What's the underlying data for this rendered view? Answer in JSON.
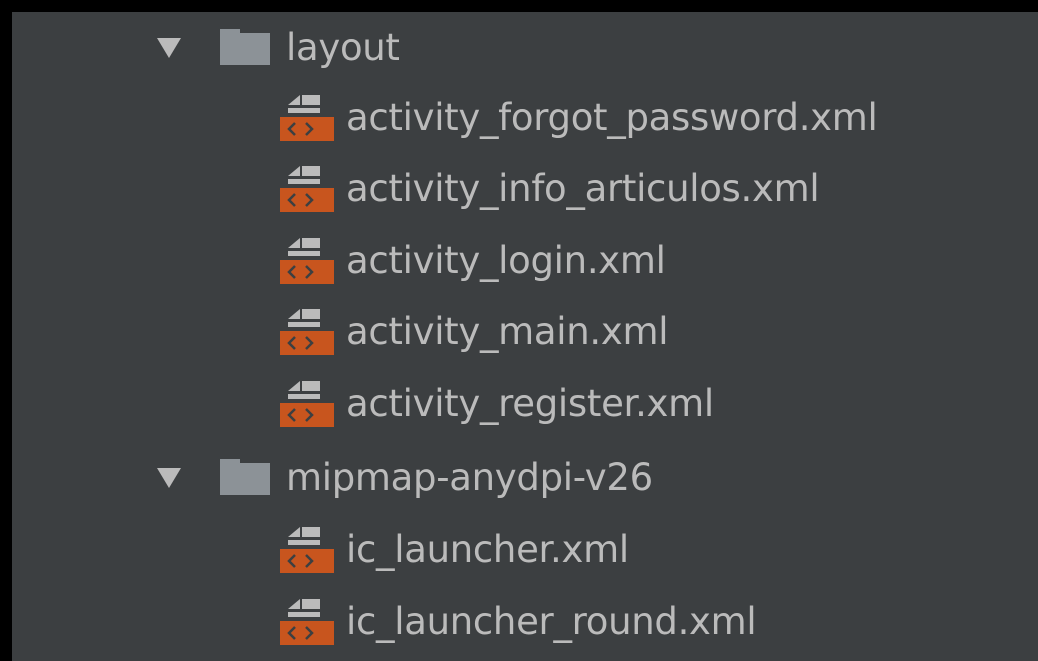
{
  "tree": {
    "folders": [
      {
        "name": "layout",
        "icon": "folder-icon",
        "expanded": true,
        "files": [
          "activity_forgot_password.xml",
          "activity_info_articulos.xml",
          "activity_login.xml",
          "activity_main.xml",
          "activity_register.xml"
        ]
      },
      {
        "name": "mipmap-anydpi-v26",
        "icon": "folder-icon",
        "expanded": true,
        "files": [
          "ic_launcher.xml",
          "ic_launcher_round.xml"
        ]
      }
    ],
    "file_icon": "xml-layout-file-icon",
    "colors": {
      "background": "#3c3f41",
      "text": "#bbbbbb",
      "folder": "#8c9297",
      "xml_badge": "#c8551e"
    }
  }
}
